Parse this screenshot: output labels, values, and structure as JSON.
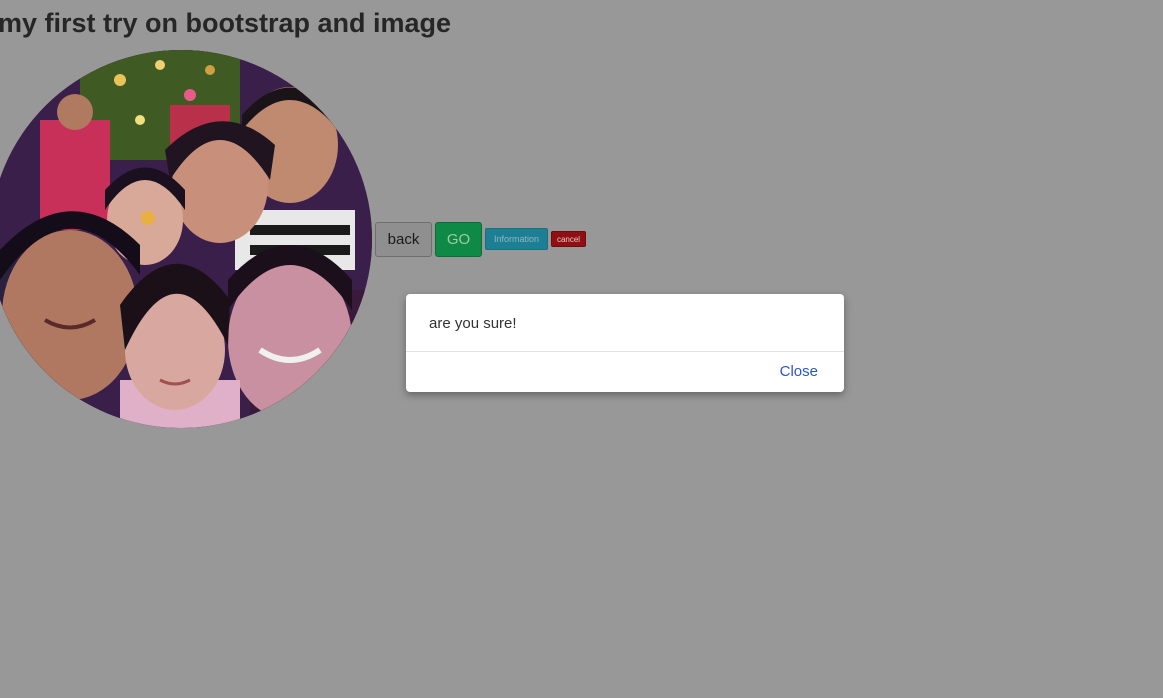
{
  "page": {
    "title": "my first try on bootstrap and image",
    "background_color": "#989898"
  },
  "photo": {
    "icon": "family-photo",
    "shape": "circle"
  },
  "buttons": {
    "back": "back",
    "go": "GO",
    "information": "Information",
    "cancel": "cancel"
  },
  "modal": {
    "message": "are you sure!",
    "close_label": "Close",
    "link_color": "#2a56c6"
  }
}
